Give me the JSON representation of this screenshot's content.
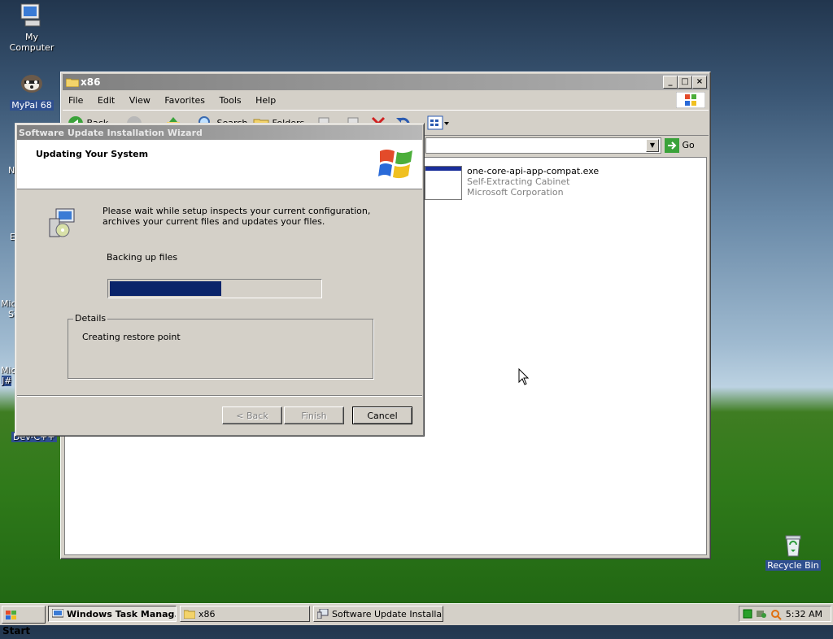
{
  "desktop": {
    "icons": [
      {
        "label": "My Computer"
      },
      {
        "label": "MyPal 68"
      },
      {
        "label": "Recycle Bin"
      },
      {
        "label": "Dev-C++"
      }
    ],
    "partial_labels": [
      "N",
      "E",
      "Micr",
      "St",
      "Micr",
      "J#"
    ]
  },
  "explorer": {
    "title": "x86",
    "menu": [
      "File",
      "Edit",
      "View",
      "Favorites",
      "Tools",
      "Help"
    ],
    "toolbar": {
      "back": "Back",
      "search": "Search",
      "folders": "Folders"
    },
    "address": {
      "value": "",
      "go_label": "Go"
    },
    "file": {
      "name": "one-core-api-app-compat.exe",
      "type": "Self-Extracting Cabinet",
      "company": "Microsoft Corporation"
    }
  },
  "wizard": {
    "title": "Software Update Installation Wizard",
    "heading": "Updating Your System",
    "description": "Please wait while setup inspects your current configuration, archives your current files and updates your files.",
    "status": "Backing up files",
    "progress": 0.53,
    "details_label": "Details",
    "details_text": "Creating restore point",
    "buttons": {
      "back": "< Back",
      "finish": "Finish",
      "cancel": "Cancel"
    }
  },
  "taskbar": {
    "start": "Start",
    "tasks": [
      {
        "label": "Windows Task Manag..."
      },
      {
        "label": "x86"
      },
      {
        "label": "Software Update Installa..."
      }
    ],
    "clock": "5:32 AM"
  },
  "colors": {
    "progress_fill": "#0a246a",
    "titlebar_inactive": "#808080"
  }
}
